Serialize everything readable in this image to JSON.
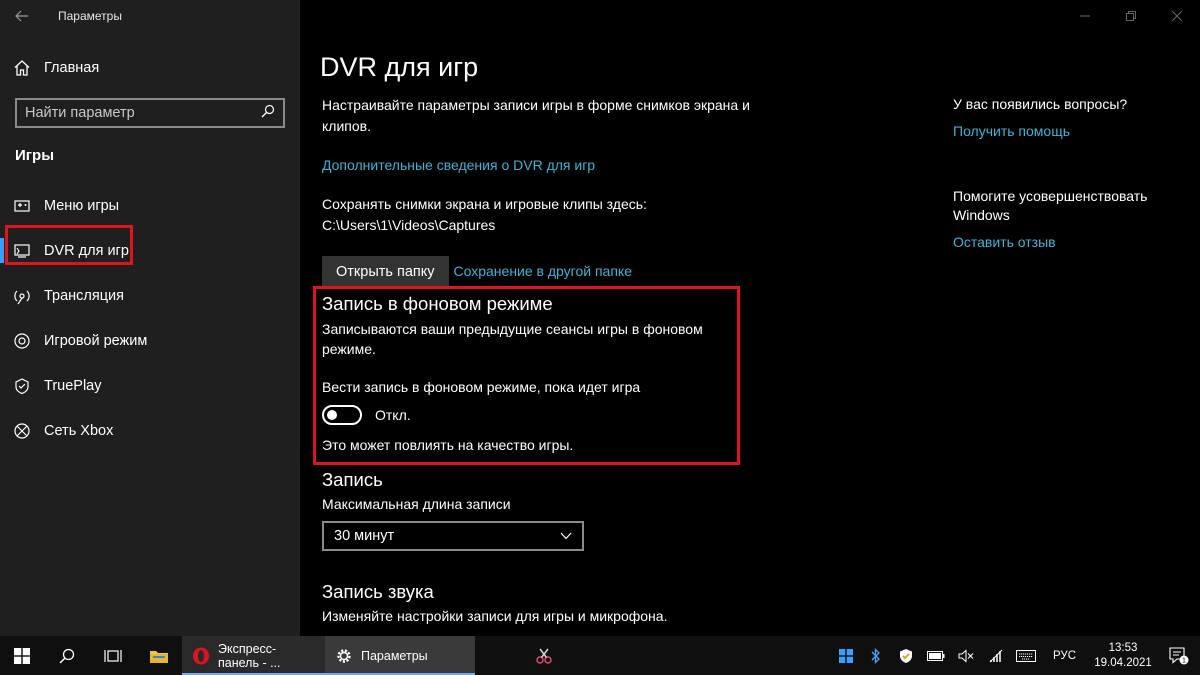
{
  "window": {
    "title": "Параметры"
  },
  "sidebar": {
    "home_label": "Главная",
    "search_placeholder": "Найти параметр",
    "section_title": "Игры",
    "items": [
      {
        "label": "Меню игры",
        "icon": "game-bar-icon"
      },
      {
        "label": "DVR для игр",
        "icon": "dvr-icon",
        "active": true
      },
      {
        "label": "Трансляция",
        "icon": "broadcast-icon"
      },
      {
        "label": "Игровой режим",
        "icon": "game-mode-icon"
      },
      {
        "label": "TruePlay",
        "icon": "trueplay-icon"
      },
      {
        "label": "Сеть Xbox",
        "icon": "xbox-icon"
      }
    ]
  },
  "main": {
    "title": "DVR для игр",
    "description": "Настраивайте параметры записи игры в форме снимков экрана и клипов.",
    "more_info_link": "Дополнительные сведения о DVR для игр",
    "save_path_text": "Сохранять снимки экрана и игровые клипы здесь: C:\\Users\\1\\Videos\\Captures",
    "open_folder_button": "Открыть папку",
    "save_elsewhere_link": "Сохранение в другой папке",
    "background": {
      "heading": "Запись в фоновом режиме",
      "description": "Записываются ваши предыдущие сеансы игры в фоновом режиме.",
      "toggle_label": "Вести запись в фоновом режиме, пока идет игра",
      "toggle_state": "Откл.",
      "toggle_on": false,
      "warning": "Это может повлиять на качество игры."
    },
    "recording": {
      "heading": "Запись",
      "max_length_label": "Максимальная длина записи",
      "max_length_value": "30 минут"
    },
    "audio": {
      "heading": "Запись звука",
      "description": "Изменяйте настройки записи для игры и микрофона."
    }
  },
  "right_panel": {
    "questions_title": "У вас появились вопросы?",
    "help_link": "Получить помощь",
    "improve_title": "Помогите усовершенствовать Windows",
    "feedback_link": "Оставить отзыв"
  },
  "taskbar": {
    "opera_label": "Экспресс-панель - ...",
    "settings_label": "Параметры",
    "language": "РУС",
    "time": "13:53",
    "date": "19.04.2021",
    "notification_count": "1"
  },
  "colors": {
    "accent": "#3aa0ff",
    "link": "#3fb3d6",
    "highlight_box": "#e0141f"
  }
}
